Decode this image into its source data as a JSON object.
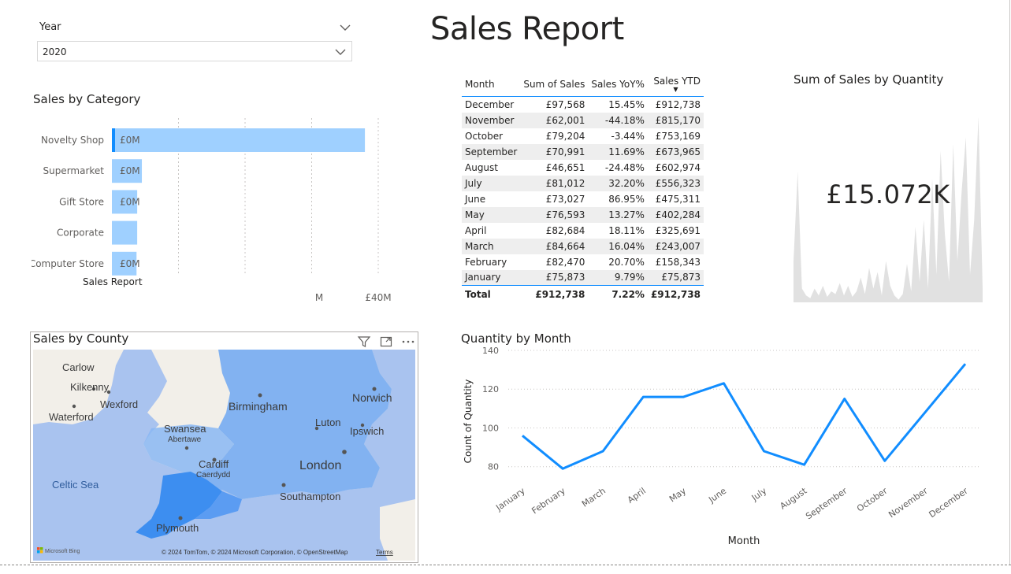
{
  "slicer": {
    "label": "Year",
    "selected": "2020"
  },
  "page_title": "Sales Report",
  "bar_visual": {
    "title": "Sales by Category",
    "footer_label": "Sales Report",
    "chart_data": {
      "type": "bar",
      "orientation": "horizontal",
      "categories": [
        "Novelty Shop",
        "Supermarket",
        "Gift Store",
        "Corporate",
        "Computer Store"
      ],
      "values": [
        38,
        4.5,
        3.8,
        3.8,
        3.7
      ],
      "data_labels": [
        "£0M",
        "£0M",
        "£0M",
        "",
        "£0M"
      ],
      "x_tick_labels": [
        "M",
        "£40M"
      ],
      "xlim": [
        0,
        40
      ],
      "grid": true,
      "highlight_color": "#118dff",
      "bar_color": "#9fd0ff"
    }
  },
  "matrix": {
    "columns": [
      "Month",
      "Sum of Sales",
      "Sales YoY%",
      "Sales YTD"
    ],
    "sort_indicator": "▼",
    "rows": [
      [
        "December",
        "£97,568",
        "15.45%",
        "£912,738"
      ],
      [
        "November",
        "£62,001",
        "-44.18%",
        "£815,170"
      ],
      [
        "October",
        "£79,204",
        "-3.44%",
        "£753,169"
      ],
      [
        "September",
        "£70,991",
        "11.69%",
        "£673,965"
      ],
      [
        "August",
        "£46,651",
        "-24.48%",
        "£602,974"
      ],
      [
        "July",
        "£81,012",
        "32.20%",
        "£556,323"
      ],
      [
        "June",
        "£73,027",
        "86.95%",
        "£475,311"
      ],
      [
        "May",
        "£76,593",
        "13.27%",
        "£402,284"
      ],
      [
        "April",
        "£82,684",
        "18.11%",
        "£325,691"
      ],
      [
        "March",
        "£84,664",
        "16.04%",
        "£243,007"
      ],
      [
        "February",
        "£82,470",
        "20.70%",
        "£158,343"
      ],
      [
        "January",
        "£75,873",
        "9.79%",
        "£75,873"
      ]
    ],
    "total": [
      "Total",
      "£912,738",
      "7.22%",
      "£912,738"
    ]
  },
  "card": {
    "title": "Sum of Sales by Quantity",
    "value": "£15.072K",
    "sparkline_color": "#e1e1e1",
    "sparkline_values": [
      30,
      95,
      10,
      5,
      3,
      10,
      5,
      12,
      4,
      8,
      6,
      14,
      5,
      12,
      4,
      8,
      18,
      6,
      25,
      10,
      22,
      5,
      30,
      12,
      5,
      2,
      6,
      28,
      8,
      55,
      15,
      60,
      10,
      90,
      20,
      110,
      50,
      15,
      115,
      30,
      80,
      120,
      20,
      60,
      135,
      10
    ]
  },
  "map_visual": {
    "title": "Sales by County",
    "icons": [
      "filter-icon",
      "focus-mode-icon",
      "more-options-icon"
    ],
    "place_labels": [
      "Carlow",
      "Kilkenny",
      "Wexford",
      "Waterford",
      "Birmingham",
      "Norwich",
      "Swansea",
      "Abertawe",
      "Luton",
      "Ipswich",
      "Cardiff",
      "Caerdydd",
      "London",
      "Celtic Sea",
      "Southampton",
      "Plymouth"
    ],
    "attribution": "© 2024 TomTom, © 2024 Microsoft Corporation, © OpenStreetMap",
    "terms_link": "Terms",
    "bing_logo": "Microsoft Bing",
    "colors": {
      "land": "#f2efe9",
      "sea": "#a9c3ef",
      "region": "#6ea7f2",
      "region_dark": "#3d8ef0"
    }
  },
  "line_visual": {
    "title": "Quantity by Month",
    "chart_data": {
      "type": "line",
      "categories": [
        "January",
        "February",
        "March",
        "April",
        "May",
        "June",
        "July",
        "August",
        "September",
        "October",
        "November",
        "December"
      ],
      "series": [
        {
          "values": [
            96,
            79,
            88,
            116,
            116,
            123,
            88,
            81,
            115,
            83,
            108,
            133
          ]
        }
      ],
      "xlabel": "Month",
      "ylabel": "Count of Quantity",
      "yticks": [
        80,
        100,
        120,
        140
      ],
      "ylim": [
        75,
        140
      ],
      "grid": true,
      "line_color": "#118dff"
    }
  }
}
